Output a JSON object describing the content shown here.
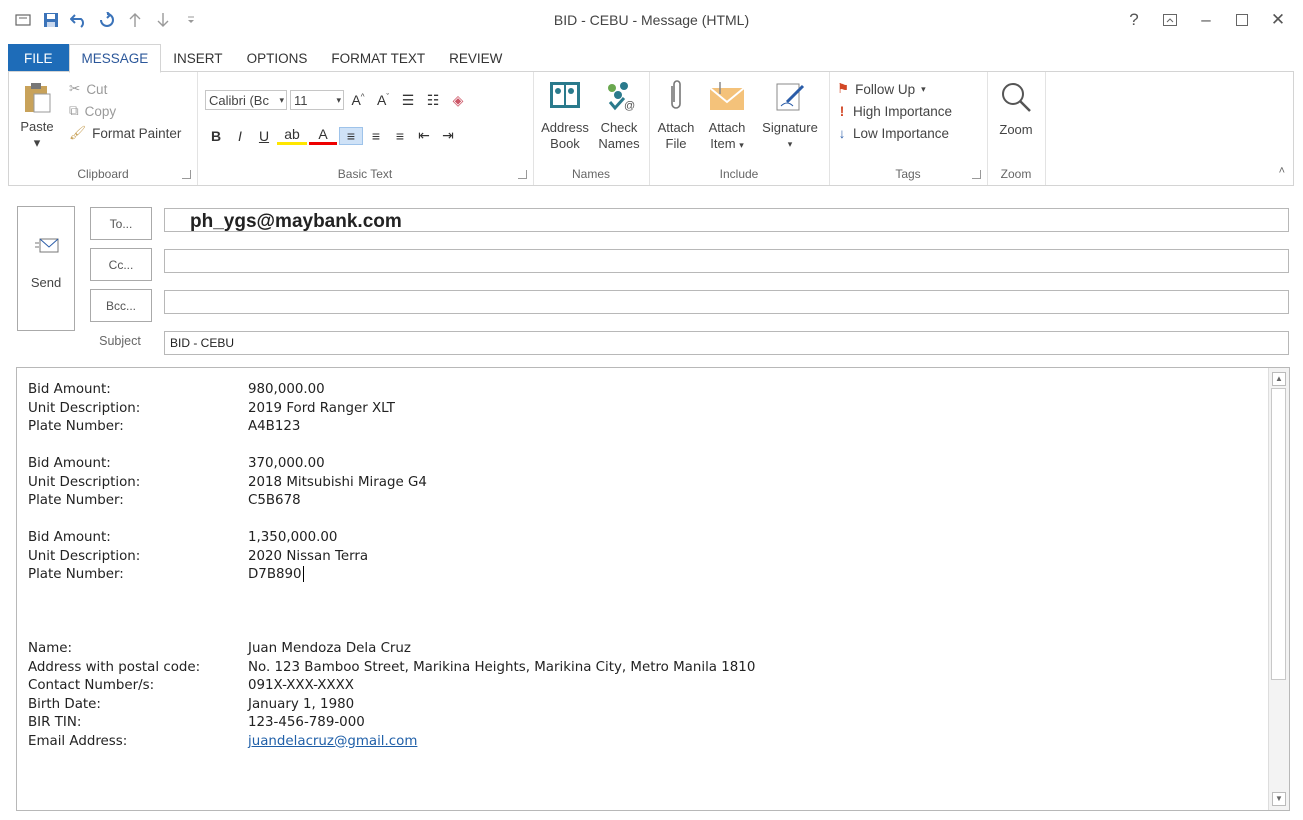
{
  "window": {
    "title": "BID - CEBU - Message (HTML)"
  },
  "quick_access": [
    {
      "icon": "mail-icon"
    },
    {
      "icon": "save-icon"
    },
    {
      "icon": "undo-icon"
    },
    {
      "icon": "redo-icon"
    },
    {
      "icon": "up-arrow-icon"
    },
    {
      "icon": "down-arrow-icon"
    },
    {
      "icon": "customize-icon"
    }
  ],
  "tabs": [
    {
      "label": "FILE"
    },
    {
      "label": "MESSAGE"
    },
    {
      "label": "INSERT"
    },
    {
      "label": "OPTIONS"
    },
    {
      "label": "FORMAT TEXT"
    },
    {
      "label": "REVIEW"
    }
  ],
  "ribbon": {
    "clipboard": {
      "label": "Clipboard",
      "paste": "Paste",
      "cut": "Cut",
      "copy": "Copy",
      "format_painter": "Format Painter"
    },
    "basic_text": {
      "label": "Basic Text",
      "font_name": "Calibri (Bc",
      "font_size": "11"
    },
    "names": {
      "label": "Names",
      "address_book_1": "Address",
      "address_book_2": "Book",
      "check_names_1": "Check",
      "check_names_2": "Names"
    },
    "include": {
      "label": "Include",
      "attach_file_1": "Attach",
      "attach_file_2": "File",
      "attach_item_1": "Attach",
      "attach_item_2": "Item",
      "signature": "Signature"
    },
    "tags": {
      "label": "Tags",
      "follow_up": "Follow Up",
      "high_importance": "High Importance",
      "low_importance": "Low Importance"
    },
    "zoom": {
      "label": "Zoom",
      "zoom_button": "Zoom"
    }
  },
  "header": {
    "send": "Send",
    "to_button": "To...",
    "cc_button": "Cc...",
    "bcc_button": "Bcc...",
    "to_value": "ph_ygs@maybank.com",
    "cc_value": "",
    "bcc_value": "",
    "subject_label": "Subject",
    "subject_value": "BID - CEBU"
  },
  "body": {
    "bids": [
      {
        "amount_label": "Bid Amount:",
        "amount": "980,000.00",
        "unit_label": "Unit Description:",
        "unit": "2019 Ford Ranger XLT",
        "plate_label": "Plate Number:",
        "plate": "A4B123"
      },
      {
        "amount_label": "Bid Amount:",
        "amount": "370,000.00",
        "unit_label": "Unit Description:",
        "unit": "2018 Mitsubishi Mirage G4",
        "plate_label": "Plate Number:",
        "plate": "C5B678"
      },
      {
        "amount_label": "Bid Amount:",
        "amount": "1,350,000.00",
        "unit_label": "Unit Description:",
        "unit": "2020 Nissan Terra",
        "plate_label": "Plate Number:",
        "plate": "D7B890"
      }
    ],
    "contact": [
      {
        "label": "Name:",
        "value": "Juan Mendoza Dela Cruz"
      },
      {
        "label": "Address with postal code:",
        "value": "No. 123 Bamboo Street, Marikina Heights, Marikina City, Metro Manila 1810"
      },
      {
        "label": "Contact Number/s:",
        "value": "091X-XXX-XXXX"
      },
      {
        "label": "Birth Date:",
        "value": "January 1, 1980"
      },
      {
        "label": "BIR TIN:",
        "value": "123-456-789-000"
      },
      {
        "label": "Email Address:",
        "value": "juandelacruz@gmail.com"
      }
    ]
  },
  "colors": {
    "accent": "#2b579a",
    "file_tab": "#1e6cb8",
    "link": "#1f5fa8",
    "flag": "#d24726"
  }
}
